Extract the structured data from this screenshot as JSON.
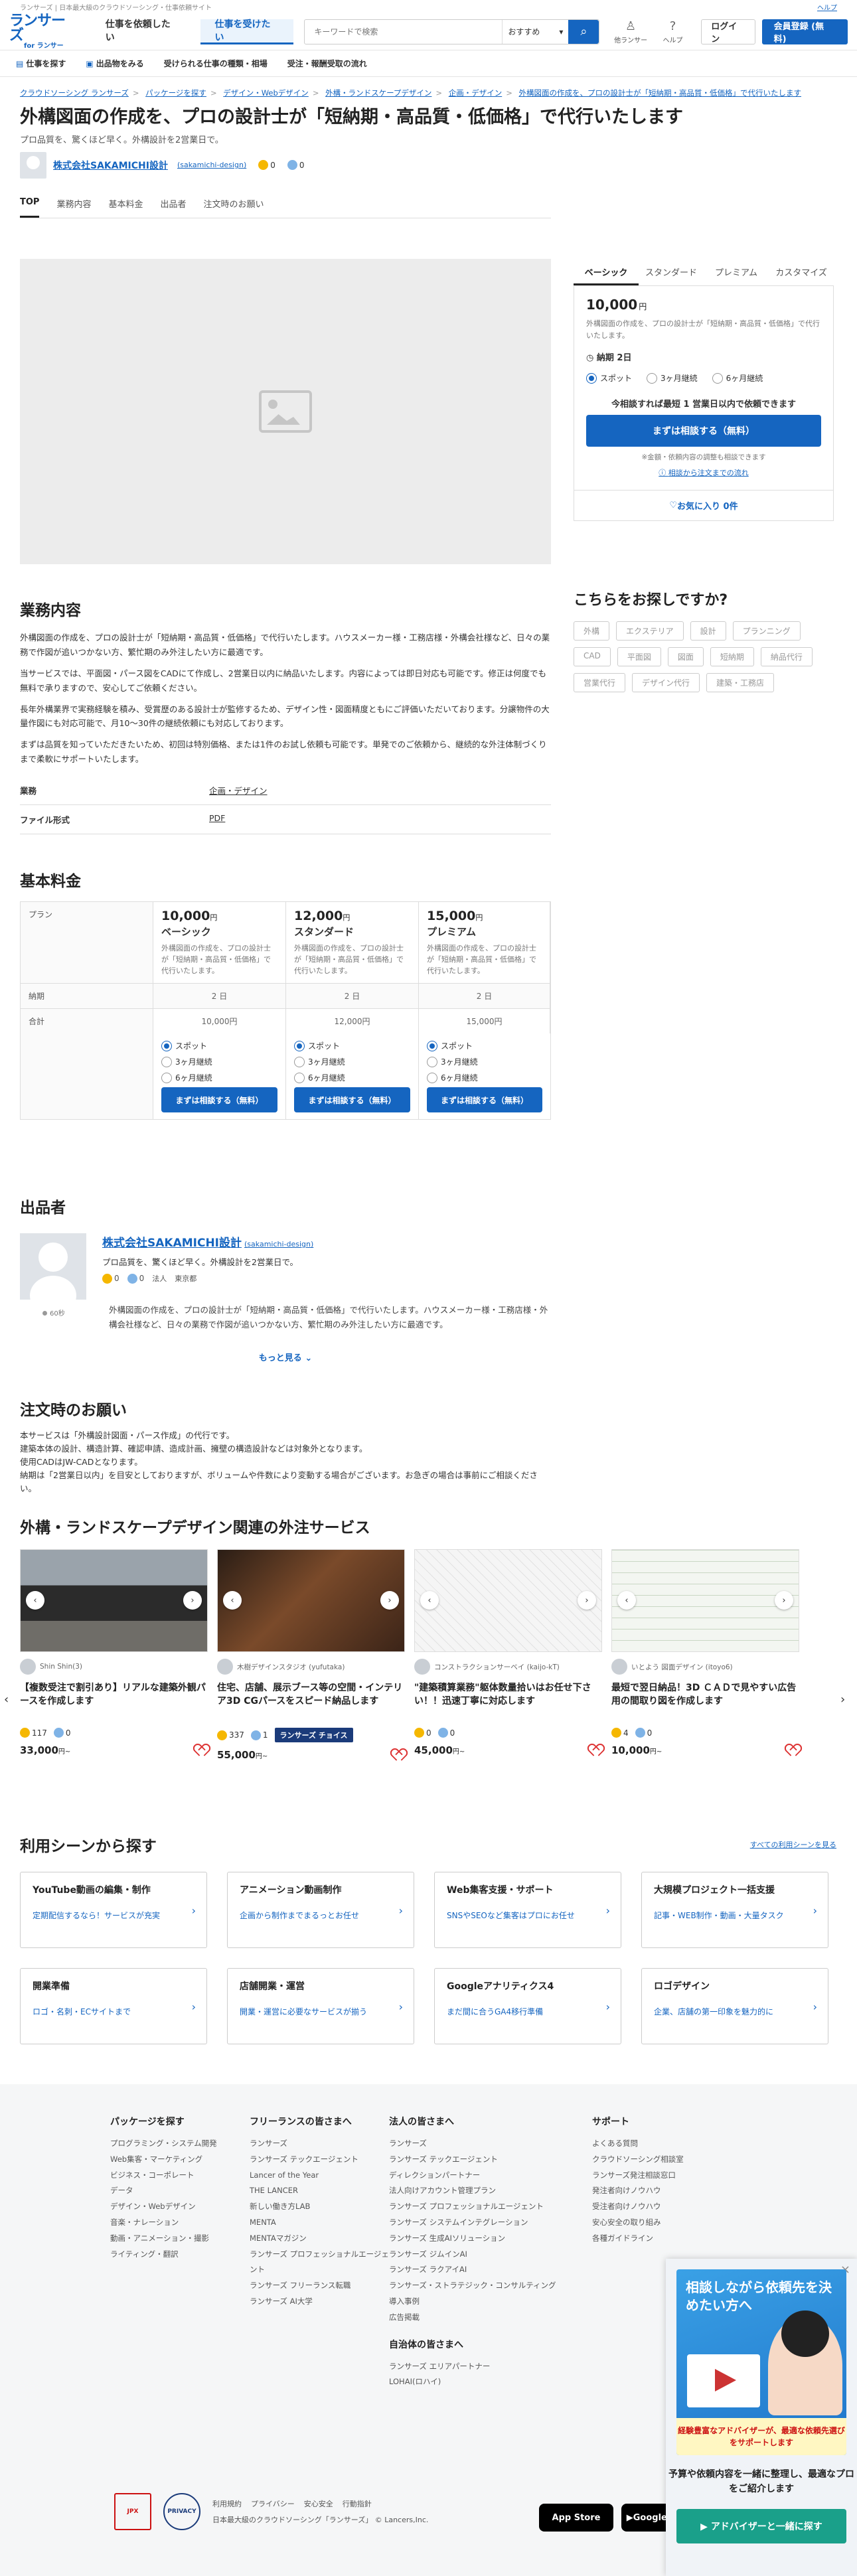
{
  "topbar": {
    "left": "ランサーズ | 日本最大級のクラウドソーシング・仕事依頼サイト",
    "help": "ヘルプ"
  },
  "header": {
    "logo_main": "ランサーズ",
    "logo_sub": "for ランサー",
    "tab_client": "仕事を依頼したい",
    "tab_worker": "仕事を受けたい",
    "search_placeholder": "キーワードで検索",
    "search_select": "おすすめ",
    "icon_lancer": "他ランサー",
    "icon_help": "ヘルプ",
    "login": "ログイン",
    "signup": "会員登録 (無料)"
  },
  "subnav": [
    "仕事を探す",
    "出品物をみる",
    "受けられる仕事の種類・相場",
    "受注・報酬受取の流れ"
  ],
  "breadcrumb": [
    "クラウドソーシング ランサーズ",
    "パッケージを探す",
    "デザイン・Webデザイン",
    "外構・ランドスケープデザイン",
    "企画・デザイン",
    "外構図面の作成を、プロの設計士が「短納期・高品質・低価格」で代行いたします"
  ],
  "title": "外構図面の作成を、プロの設計士が「短納期・高品質・低価格」で代行いたします",
  "subtitle": "プロ品質を、驚くほど早く。外構設計を2営業日で。",
  "seller": {
    "name": "株式会社SAKAMICHI設計",
    "id": "(sakamichi-design)",
    "good": "0",
    "fine": "0"
  },
  "page_tabs": [
    "TOP",
    "業務内容",
    "基本料金",
    "出品者",
    "注文時のお願い"
  ],
  "side": {
    "tabs": [
      "ベーシック",
      "スタンダード",
      "プレミアム",
      "カスタマイズ"
    ],
    "price": "10,000",
    "yen": "円",
    "desc": "外構図面の作成を、プロの設計士が「短納期・高品質・低価格」で代行いたします。",
    "delivery": "納期 2日",
    "options": [
      "スポット",
      "3ヶ月継続",
      "6ヶ月継続"
    ],
    "note": "今相談すれば最短 1 営業日以内で依頼できます",
    "cta": "まずは相談する（無料）",
    "small": "※金額・依頼内容の調整も相談できます",
    "flow": "相談から注文までの流れ",
    "fav": "お気に入り 0件"
  },
  "searchfor": {
    "title": "こちらをお探しですか?",
    "tags": [
      "外構",
      "エクステリア",
      "設計",
      "プランニング",
      "CAD",
      "平面図",
      "図面",
      "短納期",
      "納品代行",
      "営業代行",
      "デザイン代行",
      "建築・工務店"
    ]
  },
  "business": {
    "title": "業務内容",
    "paragraphs": [
      "外構図面の作成を、プロの設計士が「短納期・高品質・低価格」で代行いたします。ハウスメーカー様・工務店様・外構会社様など、日々の業務で作図が追いつかない方、繁忙期のみ外注したい方に最適です。",
      "当サービスでは、平面図・パース図をCADにて作成し、2営業日以内に納品いたします。内容によっては即日対応も可能です。修正は何度でも無料で承りますので、安心してご依頼ください。",
      "長年外構業界で実務経験を積み、受賞歴のある設計士が監修するため、デザイン性・図面精度ともにご評価いただいております。分譲物件の大量作図にも対応可能で、月10〜30件の継続依頼にも対応しております。",
      "まずは品質を知っていただきたいため、初回は特別価格、または1件のお試し依頼も可能です。単発でのご依頼から、継続的な外注体制づくりまで柔軟にサポートいたします。"
    ],
    "attrs": [
      {
        "k": "業務",
        "v": "企画・デザイン"
      },
      {
        "k": "ファイル形式",
        "v": "PDF"
      }
    ]
  },
  "pricing": {
    "title": "基本料金",
    "row_plan": "プラン",
    "row_delivery": "納期",
    "row_total": "合計",
    "plans": [
      {
        "price": "10,000",
        "name": "ベーシック",
        "desc": "外構図面の作成を、プロの設計士が「短納期・高品質・低価格」で代行いたします。",
        "delivery": "2 日",
        "total": "10,000円"
      },
      {
        "price": "12,000",
        "name": "スタンダード",
        "desc": "外構図面の作成を、プロの設計士が「短納期・高品質・低価格」で代行いたします。",
        "delivery": "2 日",
        "total": "12,000円"
      },
      {
        "price": "15,000",
        "name": "プレミアム",
        "desc": "外構図面の作成を、プロの設計士が「短納期・高品質・低価格」で代行いたします。",
        "delivery": "2 日",
        "total": "15,000円"
      }
    ],
    "yen": "円",
    "options": [
      "スポット",
      "3ヶ月継続",
      "6ヶ月継続"
    ],
    "cta": "まずは相談する（無料）"
  },
  "exhibitor": {
    "title": "出品者",
    "catch": "プロ品質を、驚くほど早く。外構設計を2営業日で。",
    "type": "法人",
    "location": "東京都",
    "status": "60秒",
    "desc": "外構図面の作成を、プロの設計士が「短納期・高品質・低価格」で代行いたします。ハウスメーカー様・工務店様・外構会社様など、日々の業務で作図が追いつかない方、繁忙期のみ外注したい方に最適です。",
    "more": "もっと見る"
  },
  "order": {
    "title": "注文時のお願い",
    "lines": [
      "本サービスは「外構設計図面・パース作成」の代行です。",
      "建築本体の設計、構造計算、確認申請、造成計画、擁壁の構造設計などは対象外となります。",
      "使用CADはJW-CADとなります。",
      "納期は「2営業日以内」を目安としておりますが、ボリュームや件数により変動する場合がございます。お急ぎの場合は事前にご相談ください。"
    ]
  },
  "related": {
    "title": "外構・ランドスケープデザイン関連の外注サービス",
    "cards": [
      {
        "seller": "Shin Shin(3)",
        "title": "【複数受注で割引あり】リアルな建築外観パースを作成します",
        "good": "117",
        "fine": "0",
        "price": "33,000",
        "choice": ""
      },
      {
        "seller": "木樹デザインスタジオ (yufutaka)",
        "title": "住宅、店舗、展示ブース等の空間・インテリア3D CGパースをスピード納品します",
        "good": "337",
        "fine": "1",
        "price": "55,000",
        "choice": "ランサーズ チョイス"
      },
      {
        "seller": "コンストラクションサーベイ (kaijo-kT)",
        "title": "\"建築積算業務\"躯体数量拾いはお任せ下さい！！迅速丁寧に対応します",
        "good": "0",
        "fine": "0",
        "price": "45,000",
        "choice": ""
      },
      {
        "seller": "いとよう 図面デザイン (itoyo6)",
        "title": "最短で翌日納品！3D ＣＡＤで見やすい広告用の間取り図を作成します",
        "good": "4",
        "fine": "0",
        "price": "10,000",
        "choice": ""
      }
    ],
    "yen": "円~"
  },
  "scenes": {
    "title": "利用シーンから探す",
    "all": "すべての利用シーンを見る",
    "items": [
      {
        "t": "YouTube動画の編集・制作",
        "s": "定期配信するなら！サービスが充実"
      },
      {
        "t": "アニメーション動画制作",
        "s": "企画から制作までまるっとお任せ"
      },
      {
        "t": "Web集客支援・サポート",
        "s": "SNSやSEOなど集客はプロにお任せ"
      },
      {
        "t": "大規模プロジェクト一括支援",
        "s": "記事・WEB制作・動画・大量タスク"
      },
      {
        "t": "開業準備",
        "s": "ロゴ・名刺・ECサイトまで"
      },
      {
        "t": "店舗開業・運営",
        "s": "開業・運営に必要なサービスが揃う"
      },
      {
        "t": "Googleアナリティクス4",
        "s": "まだ間に合うGA4移行準備"
      },
      {
        "t": "ロゴデザイン",
        "s": "企業、店舗の第一印象を魅力的に"
      }
    ]
  },
  "footer": {
    "cols": [
      {
        "h": "パッケージを探す",
        "items": [
          "プログラミング・システム開発",
          "Web集客・マーケティング",
          "ビジネス・コーポレート",
          "データ",
          "デザイン・Webデザイン",
          "音楽・ナレーション",
          "動画・アニメーション・撮影",
          "ライティング・翻訳"
        ]
      },
      {
        "h": "フリーランスの皆さまへ",
        "items": [
          "ランサーズ",
          "ランサーズ テックエージェント",
          "Lancer of the Year",
          "THE LANCER",
          "新しい働き方LAB",
          "MENTA",
          "MENTAマガジン",
          "ランサーズ プロフェッショナルエージェント",
          "ランサーズ フリーランス転職",
          "ランサーズ AI大学"
        ]
      },
      {
        "h": "法人の皆さまへ",
        "items": [
          "ランサーズ",
          "ランサーズ テックエージェント",
          "ディレクションパートナー",
          "法人向けアカウント管理プラン",
          "ランサーズ プロフェッショナルエージェント",
          "ランサーズ システムインテグレーション",
          "ランサーズ 生成AIソリューション",
          "ランサーズ ジムインAI",
          "ランサーズ ラクアイAI",
          "ランサーズ・ストラテジック・コンサルティング",
          "導入事例",
          "広告掲載"
        ],
        "sub_h": "自治体の皆さまへ",
        "sub_items": [
          "ランサーズ エリアパートナー",
          "LOHAI(ロハイ)"
        ]
      },
      {
        "h": "サポート",
        "items": [
          "よくある質問",
          "クラウドソーシング相談室",
          "ランサーズ発注相談窓口",
          "発注者向けノウハウ",
          "受注者向けノウハウ",
          "安心安全の取り組み",
          "各種ガイドライン"
        ]
      }
    ],
    "badge1": "JPX",
    "badge2": "PRIVACY",
    "links": [
      "利用規約",
      "プライバシー",
      "安心安全",
      "行動指針"
    ],
    "copy": "日本最大級のクラウドソーシング「ランサーズ」 © Lancers,Inc.",
    "appstore": "App Store",
    "playstore": "Google Play"
  },
  "popup": {
    "headline": "相談しながら依頼先を決めたい方へ",
    "band": "経験豊富なアドバイザーが、最適な依頼先選びをサポートします",
    "text": "予算や依頼内容を一緒に整理し、最適なプロをご紹介します",
    "button": "▶ アドバイザーと一緒に探す"
  }
}
